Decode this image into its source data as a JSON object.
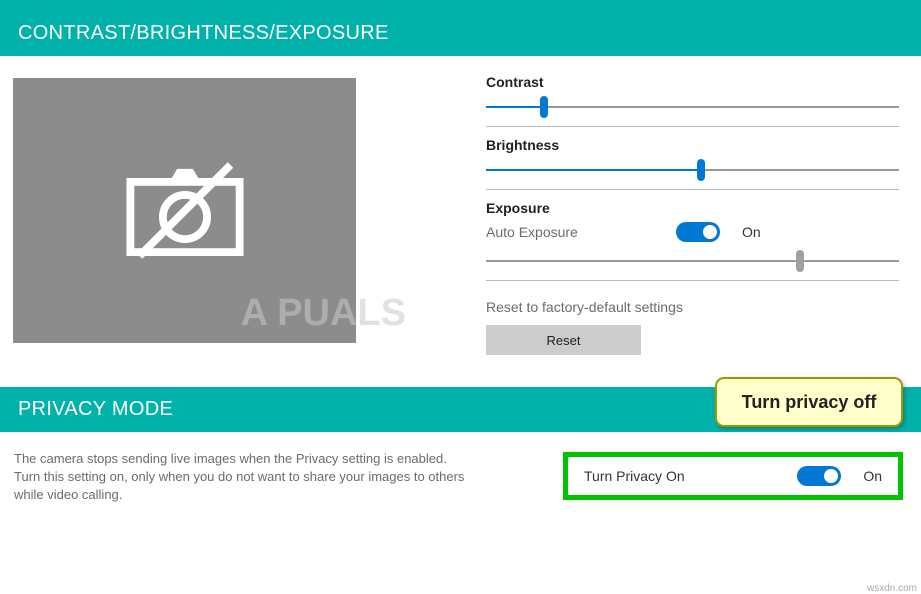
{
  "section1": {
    "title": "CONTRAST/BRIGHTNESS/EXPOSURE",
    "contrast": {
      "label": "Contrast",
      "value": 14,
      "max": 100
    },
    "brightness": {
      "label": "Brightness",
      "value": 52,
      "max": 100
    },
    "exposure": {
      "label": "Exposure",
      "auto_label": "Auto Exposure",
      "auto_state": "On",
      "value": 76,
      "max": 100
    },
    "reset_label": "Reset to factory-default settings",
    "reset_button": "Reset",
    "watermark": "A  PUALS"
  },
  "section2": {
    "title": "PRIVACY MODE",
    "description": "The camera stops sending live images when the Privacy setting is enabled. Turn this setting on, only when you do not want to share your images to others while video calling.",
    "control_label": "Turn Privacy On",
    "control_state": "On",
    "tooltip": "Turn privacy off"
  },
  "footer_watermark": "wsxdn.com"
}
